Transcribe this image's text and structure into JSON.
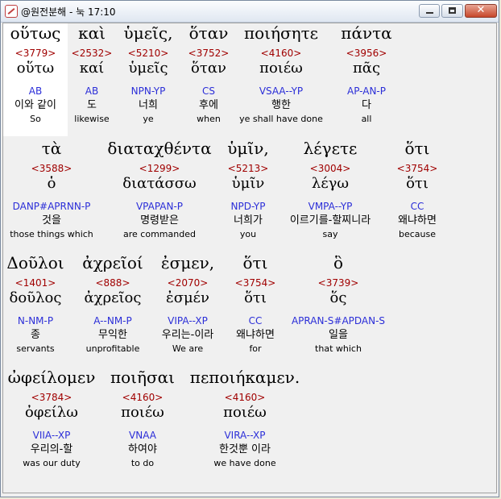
{
  "window": {
    "title": "@원전분해 - 눅 17:10"
  },
  "buttons": {
    "minimize": "",
    "maximize": "",
    "close": "✕"
  },
  "rows": [
    {
      "words": [
        {
          "greek": "οὕτως",
          "strongs": "<3779>",
          "lemma": "οὕτω",
          "parse": "AB",
          "korean": "이와 같이",
          "english": "So"
        },
        {
          "greek": "καὶ",
          "strongs": "<2532>",
          "lemma": "καί",
          "parse": "AB",
          "korean": "도",
          "english": "likewise"
        },
        {
          "greek": "ὑμεῖς,",
          "strongs": "<5210>",
          "lemma": "ὑμεῖς",
          "parse": "NPN-YP",
          "korean": "너희",
          "english": "ye"
        },
        {
          "greek": "ὅταν",
          "strongs": "<3752>",
          "lemma": "ὅταν",
          "parse": "CS",
          "korean": "후에",
          "english": "when"
        },
        {
          "greek": "ποιήσητε",
          "strongs": "<4160>",
          "lemma": "ποιέω",
          "parse": "VSAA--YP",
          "korean": "행한",
          "english": "ye shall have done"
        },
        {
          "greek": "πάντα",
          "strongs": "<3956>",
          "lemma": "πᾶς",
          "parse": "AP-AN-P",
          "korean": "다",
          "english": "all"
        }
      ]
    },
    {
      "words": [
        {
          "greek": "τὰ",
          "strongs": "<3588>",
          "lemma": "ὁ",
          "parse": "DANP#APRNN-P",
          "korean": "것을",
          "english": "those things which"
        },
        {
          "greek": "διαταχθέντα",
          "strongs": "<1299>",
          "lemma": "διατάσσω",
          "parse": "VPAPAN-P",
          "korean": "명령받은",
          "english": "are commanded"
        },
        {
          "greek": "ὑμῖν,",
          "strongs": "<5213>",
          "lemma": "ὑμῖν",
          "parse": "NPD-YP",
          "korean": "너희가",
          "english": "you"
        },
        {
          "greek": "λέγετε",
          "strongs": "<3004>",
          "lemma": "λέγω",
          "parse": "VMPA--YP",
          "korean": "이르기를-할찌니라",
          "english": "say"
        },
        {
          "greek": "ὅτι",
          "strongs": "<3754>",
          "lemma": "ὅτι",
          "parse": "CC",
          "korean": "왜냐하면",
          "english": "because"
        }
      ]
    },
    {
      "words": [
        {
          "greek": "Δοῦλοι",
          "strongs": "<1401>",
          "lemma": "δοῦλος",
          "parse": "N-NM-P",
          "korean": "종",
          "english": "servants"
        },
        {
          "greek": "ἀχρεῖοί",
          "strongs": "<888>",
          "lemma": "ἀχρεῖος",
          "parse": "A--NM-P",
          "korean": "무익한",
          "english": "unprofitable"
        },
        {
          "greek": "ἐσμεν,",
          "strongs": "<2070>",
          "lemma": "ἐσμέν",
          "parse": "VIPA--XP",
          "korean": "우리는-이라",
          "english": "We are"
        },
        {
          "greek": "ὅτι",
          "strongs": "<3754>",
          "lemma": "ὅτι",
          "parse": "CC",
          "korean": "왜냐하면",
          "english": "for"
        },
        {
          "greek": "ὃ",
          "strongs": "<3739>",
          "lemma": "ὅς",
          "parse": "APRAN-S#APDAN-S",
          "korean": "일을",
          "english": "that which"
        }
      ]
    },
    {
      "words": [
        {
          "greek": "ὠφείλομεν",
          "strongs": "<3784>",
          "lemma": "ὀφείλω",
          "parse": "VIIA--XP",
          "korean": "우리의-할",
          "english": "was our duty"
        },
        {
          "greek": "ποιῆσαι",
          "strongs": "<4160>",
          "lemma": "ποιέω",
          "parse": "VNAA",
          "korean": "하여야",
          "english": "to do"
        },
        {
          "greek": "πεποιήκαμεν.",
          "strongs": "<4160>",
          "lemma": "ποιέω",
          "parse": "VIRA--XP",
          "korean": "한것뿐 이라",
          "english": "we have done"
        }
      ]
    }
  ]
}
